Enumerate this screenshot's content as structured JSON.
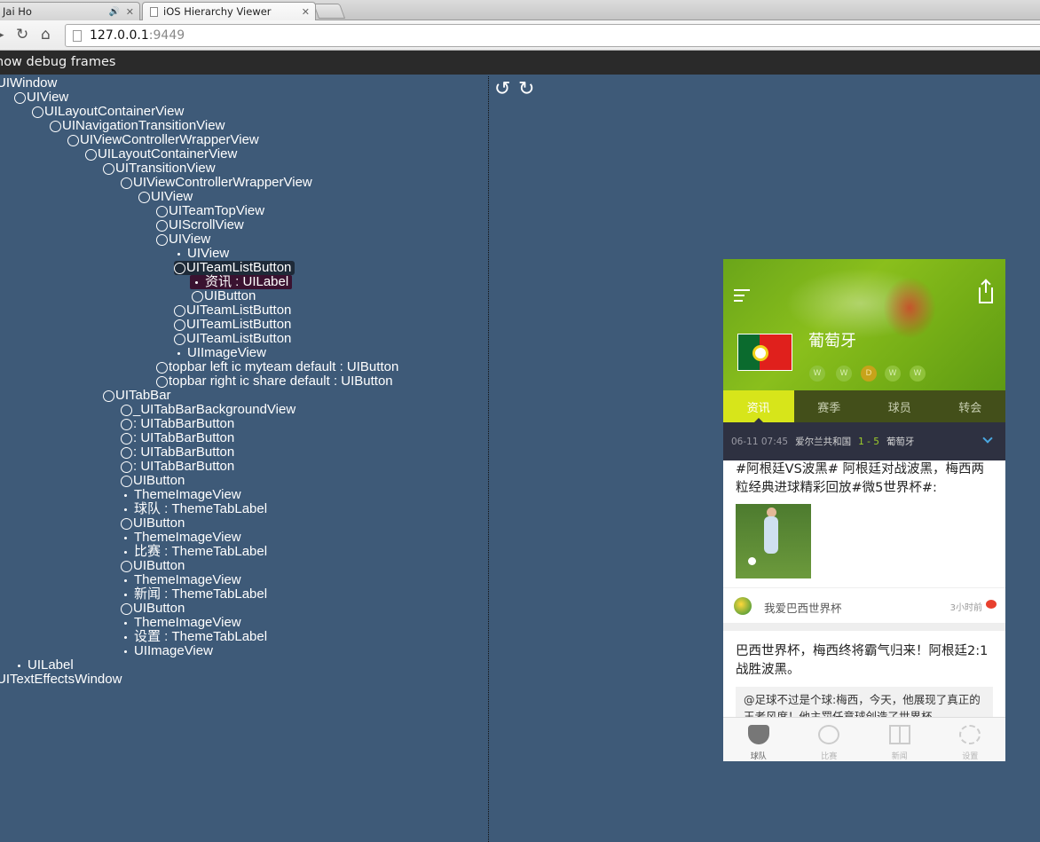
{
  "browser": {
    "tabs": [
      {
        "title": "Jai Ho",
        "audio": true
      },
      {
        "title": "iOS Hierarchy Viewer",
        "active": true
      }
    ],
    "address": {
      "host": "127.0.0.1",
      "port": ":9449"
    }
  },
  "viewer": {
    "debug_toggle": "how debug frames",
    "rotate_left": "↺",
    "rotate_right": "↻",
    "tree": [
      {
        "label": "UIWindow",
        "level": 0,
        "marker": "none"
      },
      {
        "label": "UIView",
        "level": 1,
        "marker": "circle"
      },
      {
        "label": "UILayoutContainerView",
        "level": 2,
        "marker": "circle"
      },
      {
        "label": "UINavigationTransitionView",
        "level": 3,
        "marker": "circle"
      },
      {
        "label": "UIViewControllerWrapperView",
        "level": 4,
        "marker": "circle"
      },
      {
        "label": "UILayoutContainerView",
        "level": 5,
        "marker": "circle"
      },
      {
        "label": "UITransitionView",
        "level": 6,
        "marker": "circle"
      },
      {
        "label": "UIViewControllerWrapperView",
        "level": 7,
        "marker": "circle"
      },
      {
        "label": "UIView",
        "level": 8,
        "marker": "circle"
      },
      {
        "label": "UITeamTopView",
        "level": 9,
        "marker": "circle"
      },
      {
        "label": "UIScrollView",
        "level": 9,
        "marker": "circle"
      },
      {
        "label": "UIView",
        "level": 9,
        "marker": "circle"
      },
      {
        "label": "UIView",
        "level": 10,
        "marker": "dot"
      },
      {
        "label": "UITeamListButton",
        "level": 10,
        "marker": "circle",
        "highlight": "hover"
      },
      {
        "label": "资讯 : UILabel",
        "level": 11,
        "marker": "dot",
        "highlight": "selected"
      },
      {
        "label": "UIButton",
        "level": 11,
        "marker": "circle"
      },
      {
        "label": "UITeamListButton",
        "level": 10,
        "marker": "circle"
      },
      {
        "label": "UITeamListButton",
        "level": 10,
        "marker": "circle"
      },
      {
        "label": "UITeamListButton",
        "level": 10,
        "marker": "circle"
      },
      {
        "label": "UIImageView",
        "level": 10,
        "marker": "dot"
      },
      {
        "label": "topbar left ic myteam default : UIButton",
        "level": 9,
        "marker": "circle"
      },
      {
        "label": "topbar right ic share default : UIButton",
        "level": 9,
        "marker": "circle"
      },
      {
        "label": "UITabBar",
        "level": 6,
        "marker": "circle"
      },
      {
        "label": "_UITabBarBackgroundView",
        "level": 7,
        "marker": "circle"
      },
      {
        "label": " : UITabBarButton",
        "level": 7,
        "marker": "circle"
      },
      {
        "label": " : UITabBarButton",
        "level": 7,
        "marker": "circle"
      },
      {
        "label": " : UITabBarButton",
        "level": 7,
        "marker": "circle"
      },
      {
        "label": " : UITabBarButton",
        "level": 7,
        "marker": "circle"
      },
      {
        "label": "UIButton",
        "level": 7,
        "marker": "circle"
      },
      {
        "label": "ThemeImageView",
        "level": 7,
        "marker": "dot"
      },
      {
        "label": "球队 : ThemeTabLabel",
        "level": 7,
        "marker": "dot"
      },
      {
        "label": "UIButton",
        "level": 7,
        "marker": "circle"
      },
      {
        "label": "ThemeImageView",
        "level": 7,
        "marker": "dot"
      },
      {
        "label": "比赛 : ThemeTabLabel",
        "level": 7,
        "marker": "dot"
      },
      {
        "label": "UIButton",
        "level": 7,
        "marker": "circle"
      },
      {
        "label": "ThemeImageView",
        "level": 7,
        "marker": "dot"
      },
      {
        "label": "新闻 : ThemeTabLabel",
        "level": 7,
        "marker": "dot"
      },
      {
        "label": "UIButton",
        "level": 7,
        "marker": "circle"
      },
      {
        "label": "ThemeImageView",
        "level": 7,
        "marker": "dot"
      },
      {
        "label": "设置 : ThemeTabLabel",
        "level": 7,
        "marker": "dot"
      },
      {
        "label": "UIImageView",
        "level": 7,
        "marker": "dot"
      },
      {
        "label": "UILabel",
        "level": 1,
        "marker": "dot"
      },
      {
        "label": "UITextEffectsWindow",
        "level": 0,
        "marker": "none"
      }
    ]
  },
  "phone": {
    "team_name": "葡萄牙",
    "form": [
      "W",
      "W",
      "D",
      "W",
      "W"
    ],
    "tabs": [
      "资讯",
      "赛季",
      "球员",
      "转会"
    ],
    "active_tab": 0,
    "match": {
      "time": "06-11 07:45",
      "home": "爱尔兰共和国",
      "score": "1 - 5",
      "away": "葡萄牙"
    },
    "post1": {
      "text": "#阿根廷VS波黑# 阿根廷对战波黑，梅西两粒经典进球精彩回放#微5世界杯#:",
      "source": "我爱巴西世界杯",
      "ago": "3小时前"
    },
    "post2": {
      "text": "巴西世界杯，梅西终将霸气归来！阿根廷2:1战胜波黑。",
      "quote": "@足球不过是个球:梅西，今天，他展现了真正的王者风度！他主罚任意球创造了世界杯"
    },
    "tabbar": [
      "球队",
      "比赛",
      "新闻",
      "设置"
    ],
    "colors": {
      "accent": "#d7e51a",
      "header_green": "#7fb51a",
      "score_green": "#9fcf2a",
      "viewer_bg": "#3e5a78"
    }
  }
}
